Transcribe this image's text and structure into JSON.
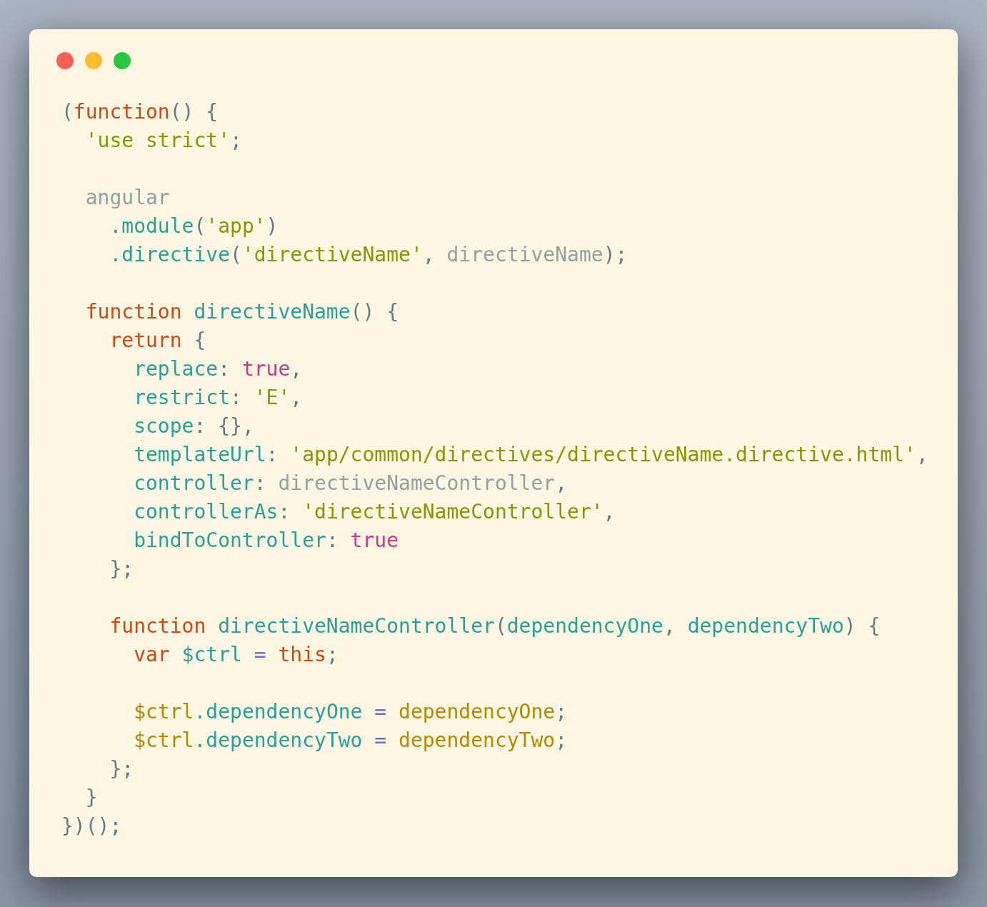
{
  "window_controls": [
    {
      "color": "#ff5f56"
    },
    {
      "color": "#ffbd2e"
    },
    {
      "color": "#27c93f"
    }
  ],
  "code_blocks": [
    {
      "lines": [
        {
          "tokens": [
            {
              "text": "(",
              "kind": "punct"
            },
            {
              "text": "function",
              "kind": "kw"
            },
            {
              "text": "() {",
              "kind": "punct"
            }
          ]
        },
        {
          "tokens": [
            {
              "text": "  'use strict'",
              "kind": "str"
            },
            {
              "text": ";",
              "kind": "punct"
            }
          ]
        }
      ]
    },
    {
      "lines": [
        {
          "tokens": [
            {
              "text": "  angular",
              "kind": "ident"
            }
          ]
        },
        {
          "tokens": [
            {
              "text": "    .module",
              "kind": "prop"
            },
            {
              "text": "(",
              "kind": "punct"
            },
            {
              "text": "'app'",
              "kind": "str"
            },
            {
              "text": ")",
              "kind": "punct"
            }
          ]
        },
        {
          "tokens": [
            {
              "text": "    .directive",
              "kind": "prop"
            },
            {
              "text": "(",
              "kind": "punct"
            },
            {
              "text": "'directiveName'",
              "kind": "str"
            },
            {
              "text": ", ",
              "kind": "punct"
            },
            {
              "text": "directiveName",
              "kind": "ident"
            },
            {
              "text": ");",
              "kind": "punct"
            }
          ]
        }
      ]
    },
    {
      "lines": [
        {
          "tokens": [
            {
              "text": "  function ",
              "kind": "kw"
            },
            {
              "text": "directiveName",
              "kind": "prop"
            },
            {
              "text": "() {",
              "kind": "punct"
            }
          ]
        },
        {
          "tokens": [
            {
              "text": "    return",
              "kind": "kw"
            },
            {
              "text": " {",
              "kind": "punct"
            }
          ]
        },
        {
          "tokens": [
            {
              "text": "      replace",
              "kind": "prop"
            },
            {
              "text": ": ",
              "kind": "punct"
            },
            {
              "text": "true",
              "kind": "bool"
            },
            {
              "text": ",",
              "kind": "punct"
            }
          ]
        },
        {
          "tokens": [
            {
              "text": "      restrict",
              "kind": "prop"
            },
            {
              "text": ": ",
              "kind": "punct"
            },
            {
              "text": "'E'",
              "kind": "str"
            },
            {
              "text": ",",
              "kind": "punct"
            }
          ]
        },
        {
          "tokens": [
            {
              "text": "      scope",
              "kind": "prop"
            },
            {
              "text": ": {},",
              "kind": "punct"
            }
          ]
        },
        {
          "tokens": [
            {
              "text": "      templateUrl",
              "kind": "prop"
            },
            {
              "text": ": ",
              "kind": "punct"
            },
            {
              "text": "'app/common/directives/directiveName.directive.html'",
              "kind": "str"
            },
            {
              "text": ",",
              "kind": "punct"
            }
          ]
        },
        {
          "tokens": [
            {
              "text": "      controller",
              "kind": "prop"
            },
            {
              "text": ": ",
              "kind": "punct"
            },
            {
              "text": "directiveNameController",
              "kind": "ident"
            },
            {
              "text": ",",
              "kind": "punct"
            }
          ]
        },
        {
          "tokens": [
            {
              "text": "      controllerAs",
              "kind": "prop"
            },
            {
              "text": ": ",
              "kind": "punct"
            },
            {
              "text": "'directiveNameController'",
              "kind": "str"
            },
            {
              "text": ",",
              "kind": "punct"
            }
          ]
        },
        {
          "tokens": [
            {
              "text": "      bindToController",
              "kind": "prop"
            },
            {
              "text": ": ",
              "kind": "punct"
            },
            {
              "text": "true",
              "kind": "bool"
            }
          ]
        },
        {
          "tokens": [
            {
              "text": "    };",
              "kind": "punct"
            }
          ]
        }
      ]
    },
    {
      "lines": [
        {
          "tokens": [
            {
              "text": "    function ",
              "kind": "kw"
            },
            {
              "text": "directiveNameController",
              "kind": "prop"
            },
            {
              "text": "(",
              "kind": "punct"
            },
            {
              "text": "dependencyOne",
              "kind": "prop"
            },
            {
              "text": ", ",
              "kind": "punct"
            },
            {
              "text": "dependencyTwo",
              "kind": "prop"
            },
            {
              "text": ") {",
              "kind": "punct"
            }
          ]
        },
        {
          "tokens": [
            {
              "text": "      var ",
              "kind": "kw"
            },
            {
              "text": "$ctrl ",
              "kind": "prop"
            },
            {
              "text": "= ",
              "kind": "op"
            },
            {
              "text": "this",
              "kind": "kw"
            },
            {
              "text": ";",
              "kind": "punct"
            }
          ]
        }
      ]
    },
    {
      "lines": [
        {
          "tokens": [
            {
              "text": "      $ctrl",
              "kind": "var"
            },
            {
              "text": ".dependencyOne ",
              "kind": "prop"
            },
            {
              "text": "= ",
              "kind": "op"
            },
            {
              "text": "dependencyOne",
              "kind": "var"
            },
            {
              "text": ";",
              "kind": "punct"
            }
          ]
        },
        {
          "tokens": [
            {
              "text": "      $ctrl",
              "kind": "var"
            },
            {
              "text": ".dependencyTwo ",
              "kind": "prop"
            },
            {
              "text": "= ",
              "kind": "op"
            },
            {
              "text": "dependencyTwo",
              "kind": "var"
            },
            {
              "text": ";",
              "kind": "punct"
            }
          ]
        },
        {
          "tokens": [
            {
              "text": "    };",
              "kind": "punct"
            }
          ]
        },
        {
          "tokens": [
            {
              "text": "  }",
              "kind": "punct"
            }
          ]
        },
        {
          "tokens": [
            {
              "text": "})();",
              "kind": "punct"
            }
          ]
        }
      ]
    }
  ]
}
